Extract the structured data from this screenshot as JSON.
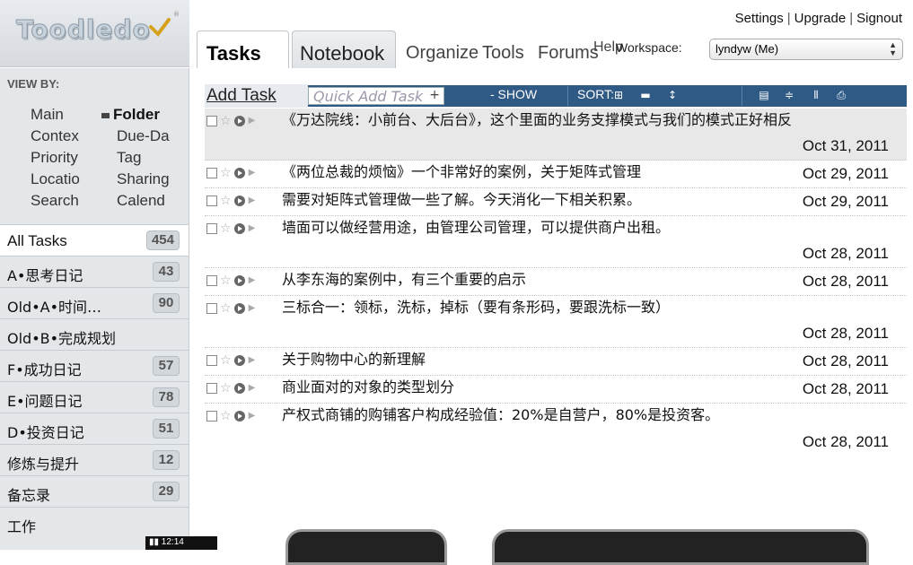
{
  "header": {
    "logo": "Toodledo",
    "links": [
      "Settings",
      "Upgrade",
      "Signout"
    ],
    "tabs": [
      "Tasks",
      "Notebook",
      "Organize",
      "Tools",
      "Forums",
      "Help"
    ],
    "workspace_label": "Workspace:",
    "workspace_value": "lyndyw (Me)"
  },
  "sidebar": {
    "viewby_title": "VIEW BY:",
    "viewby": [
      [
        "Main",
        "Folder"
      ],
      [
        "Contex",
        "Due-Da"
      ],
      [
        "Priority",
        "Tag"
      ],
      [
        "Locatio",
        "Sharing"
      ],
      [
        "Search",
        "Calend"
      ]
    ],
    "folders": [
      {
        "label": "All Tasks",
        "count": "454"
      },
      {
        "label": "A•思考日记",
        "count": "43"
      },
      {
        "label": "Old•A•时间…",
        "count": "90"
      },
      {
        "label": "Old•B•完成规划",
        "count": ""
      },
      {
        "label": "F•成功日记",
        "count": "57"
      },
      {
        "label": "E•问题日记",
        "count": "78"
      },
      {
        "label": "D•投资日记",
        "count": "51"
      },
      {
        "label": "修炼与提升",
        "count": "12"
      },
      {
        "label": "备忘录",
        "count": "29"
      },
      {
        "label": "工作",
        "count": ""
      }
    ]
  },
  "toolbar": {
    "add_task": "Add Task",
    "quick_add_placeholder": "Quick Add Task",
    "quick_add_plus": "+",
    "show": "- SHOW",
    "sort": "SORT:"
  },
  "tasks": [
    {
      "title": "《万达院线：小前台、大后台》，这个里面的业务支撑模式与我们的模式正好相反",
      "date": "Oct 31, 2011"
    },
    {
      "title": "《两位总裁的烦恼》一个非常好的案例，关于矩阵式管理",
      "date": "Oct 29, 2011"
    },
    {
      "title": "需要对矩阵式管理做一些了解。今天消化一下相关积累。",
      "date": "Oct 29, 2011"
    },
    {
      "title": "墙面可以做经营用途，由管理公司管理，可以提供商户出租。",
      "date": "Oct 28, 2011"
    },
    {
      "title": "从李东海的案例中，有三个重要的启示",
      "date": "Oct 28, 2011"
    },
    {
      "title": "三标合一：领标，洗标，掉标（要有条形码，要跟洗标一致）",
      "date": "Oct 28, 2011"
    },
    {
      "title": "关于购物中心的新理解",
      "date": "Oct 28, 2011"
    },
    {
      "title": "商业面对的对象的类型划分",
      "date": "Oct 28, 2011"
    },
    {
      "title": "产权式商铺的购铺客户构成经验值：20%是自营户，80%是投资客。",
      "date": "Oct 28, 2011"
    }
  ],
  "status_bar": {
    "time": "12:14"
  }
}
